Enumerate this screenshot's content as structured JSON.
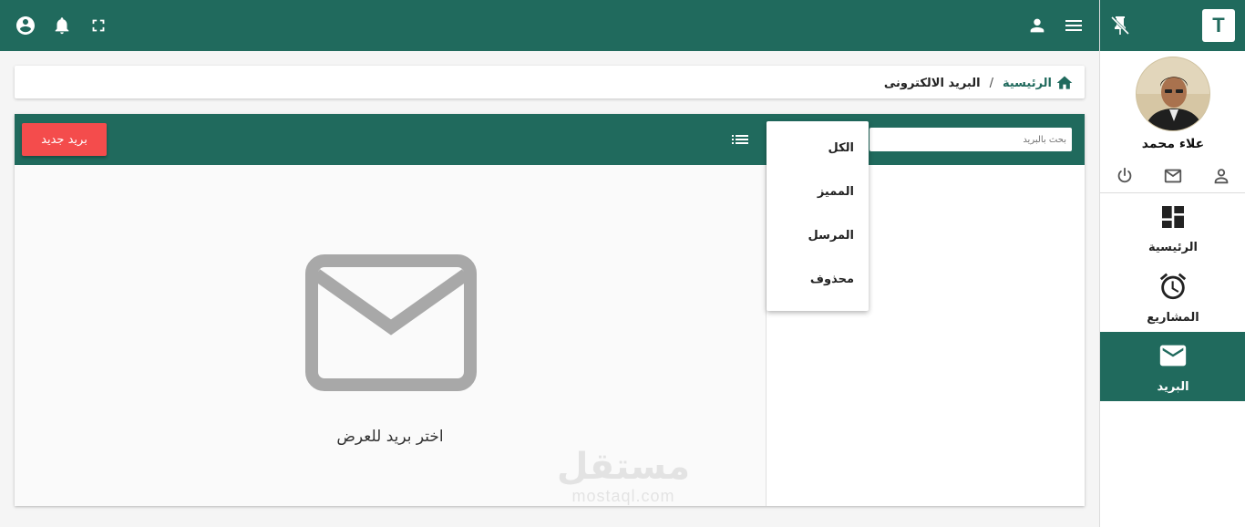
{
  "sidebar": {
    "logo_letter": "T",
    "user_name": "علاء محمد",
    "nav_items": [
      {
        "label": "الرئيسية",
        "icon": "dashboard-icon"
      },
      {
        "label": "المشاريع",
        "icon": "alarm-clock-icon"
      },
      {
        "label": "البريد",
        "icon": "mail-icon",
        "active": true
      }
    ]
  },
  "breadcrumb": {
    "home": "الرئيسية",
    "separator": "/",
    "current": "البريد الالكترونى"
  },
  "mail": {
    "search_placeholder": "بحث بالبريد",
    "new_button": "بريد جديد",
    "filters": [
      "الكل",
      "المميز",
      "المرسل",
      "محذوف"
    ],
    "empty_message": "اختر بريد للعرض"
  },
  "watermark": {
    "arabic": "مستقل",
    "latin": "mostaql.com"
  },
  "colors": {
    "primary": "#206a5d",
    "accent": "#f44c4c",
    "placeholder_icon": "#a8a8a8"
  }
}
